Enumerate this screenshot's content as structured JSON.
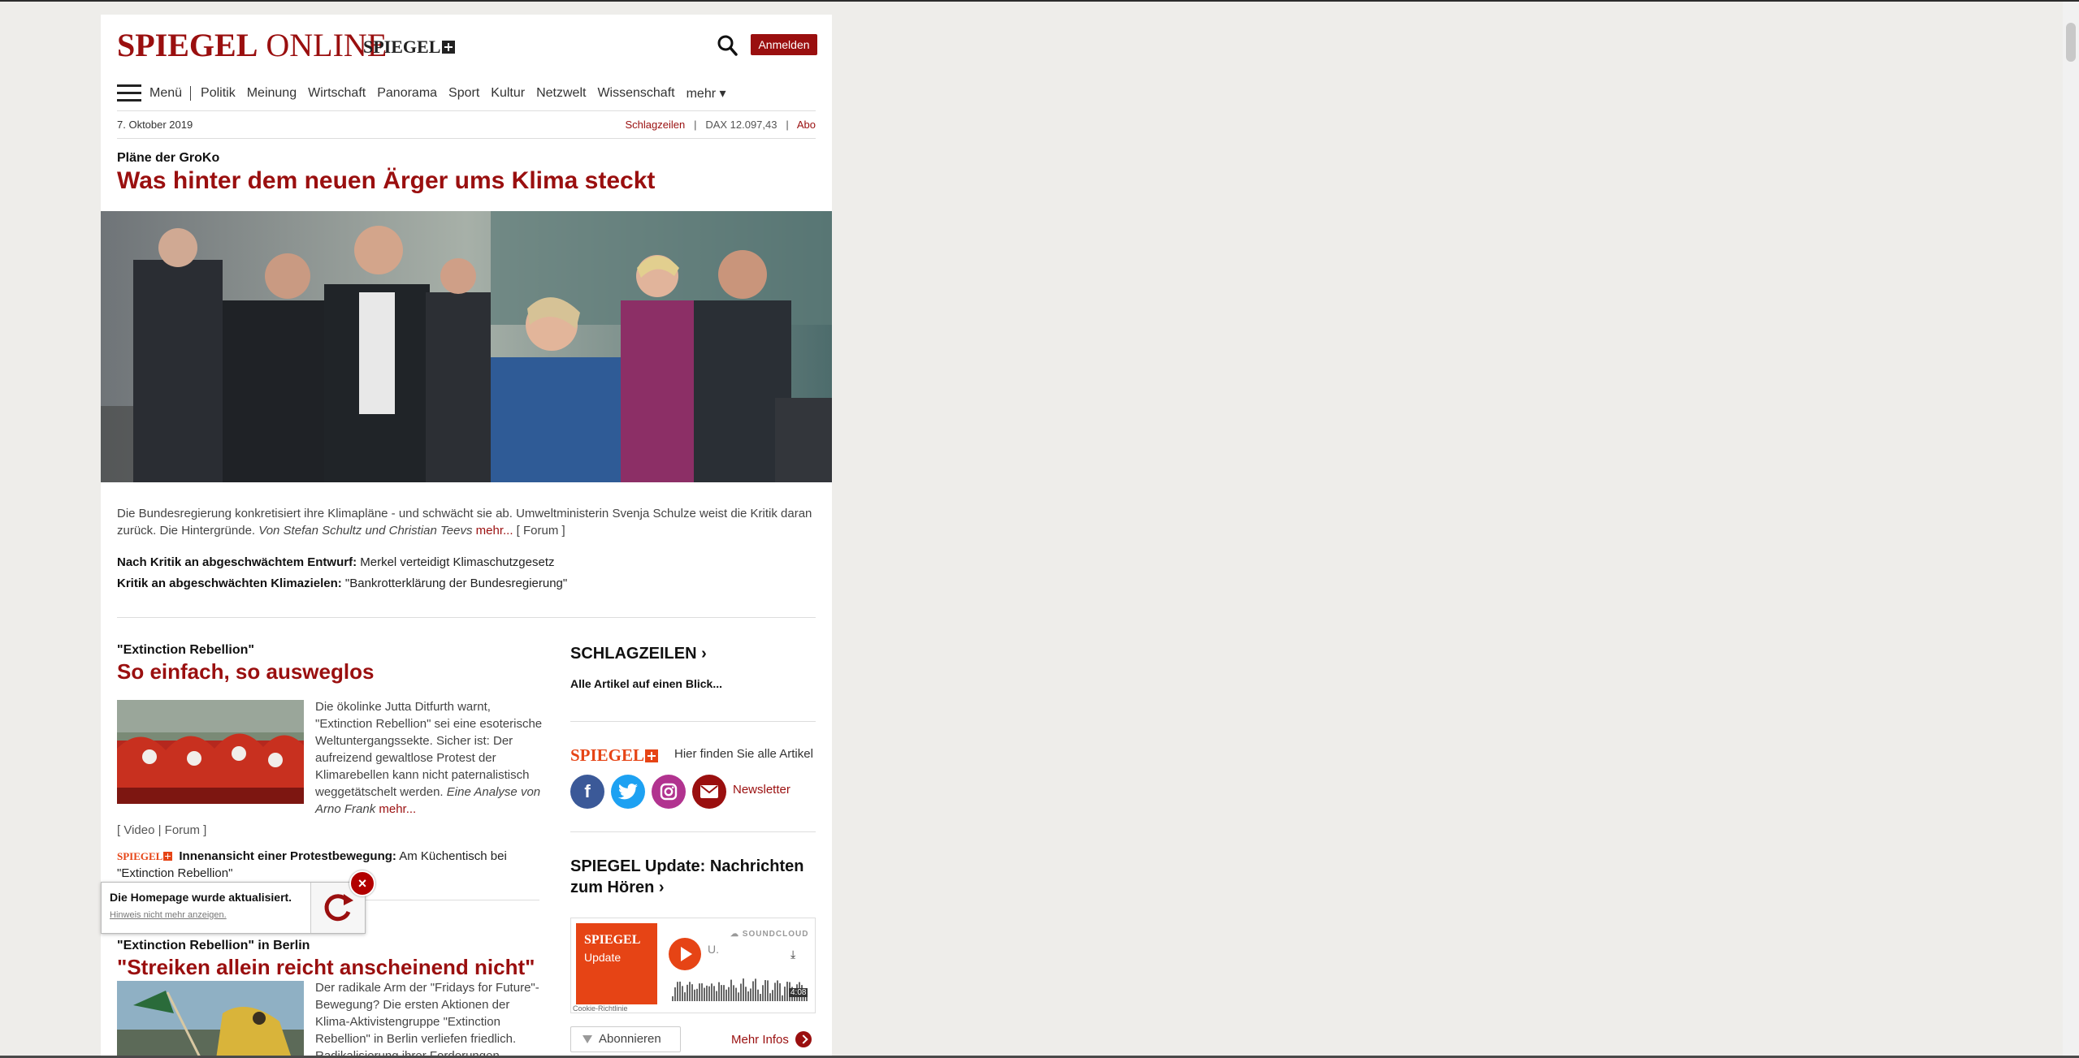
{
  "header": {
    "logo_left": "SPIEGEL",
    "logo_right": "ONLINE",
    "plus_logo": "SPIEGEL",
    "login_label": "Anmelden"
  },
  "nav": {
    "menu_label": "Menü",
    "items": [
      "Politik",
      "Meinung",
      "Wirtschaft",
      "Panorama",
      "Sport",
      "Kultur",
      "Netzwelt",
      "Wissenschaft",
      "mehr ▾"
    ]
  },
  "subbar": {
    "date": "7. Oktober 2019",
    "headlines_link": "Schlagzeilen",
    "dax": "DAX 12.097,43",
    "abo_link": "Abo",
    "separator": "|"
  },
  "lead": {
    "kicker": "Pläne der GroKo",
    "title": "Was hinter dem neuen Ärger ums Klima steckt",
    "teaser": "Die Bundesregierung konkretisiert ihre Klimapläne - und schwächt sie ab. Umweltministerin Svenja Schulze weist die Kritik daran zurück. Die Hintergründe.",
    "author": "Von Stefan Schultz und Christian Teevs",
    "more": "mehr...",
    "forum": "[ Forum ]",
    "related": [
      {
        "bold": "Nach Kritik an abgeschwächtem Entwurf:",
        "text": " Merkel verteidigt Klimaschutzgesetz"
      },
      {
        "bold": "Kritik an abgeschwächten Klimazielen:",
        "text": " \"Bankrotterklärung der Bundesregierung\""
      }
    ]
  },
  "article1": {
    "kicker": "\"Extinction Rebellion\"",
    "title": "So einfach, so ausweglos",
    "teaser": "Die ökolinke Jutta Ditfurth warnt, \"Extinction Rebellion\" sei eine esoterische Weltuntergangssekte. Sicher ist: Der aufreizend gewaltlose Protest der Klimarebellen kann nicht paternalistisch weggetätschelt werden.",
    "author": "Eine Analyse von Arno Frank",
    "more": "mehr...",
    "links": "[ Video | Forum ]",
    "related_plus": "SPIEGEL",
    "related_bold": "Innenansicht einer Protestbewegung:",
    "related_text": " Am Küchentisch bei \"Extinction Rebellion\""
  },
  "article2": {
    "kicker": "\"Extinction Rebellion\" in Berlin",
    "title": "\"Streiken allein reicht anscheinend nicht\"",
    "teaser": "Der radikale Arm der \"Fridays for Future\"-Bewegung? Die ersten Aktionen der Klima-Aktivistengruppe \"Extinction Rebellion\" in Berlin verliefen friedlich. Radikalisierung ihrer Forderungen"
  },
  "sidebar": {
    "headlines_title": "SCHLAGZEILEN",
    "headlines_sub": "Alle Artikel auf einen Blick...",
    "plus_logo": "SPIEGEL",
    "plus_text": "Hier finden Sie alle Artikel",
    "newsletter": "Newsletter",
    "update_title": "SPIEGEL Update: Nachrichten zum Hören",
    "player": {
      "art_title": "SPIEGEL",
      "art_sub": "Update",
      "track_initial": "U.",
      "brand": "SOUNDCLOUD",
      "duration": "4:08",
      "cookie": "Cookie-Richtlinie"
    },
    "abo_button": "Abonnieren",
    "more_info": "Mehr Infos"
  },
  "popup": {
    "title": "Die Homepage wurde aktualisiert.",
    "hint": "Hinweis nicht mehr anzeigen."
  },
  "colors": {
    "brand_red": "#9a0f0f",
    "plus_orange": "#e64415"
  }
}
